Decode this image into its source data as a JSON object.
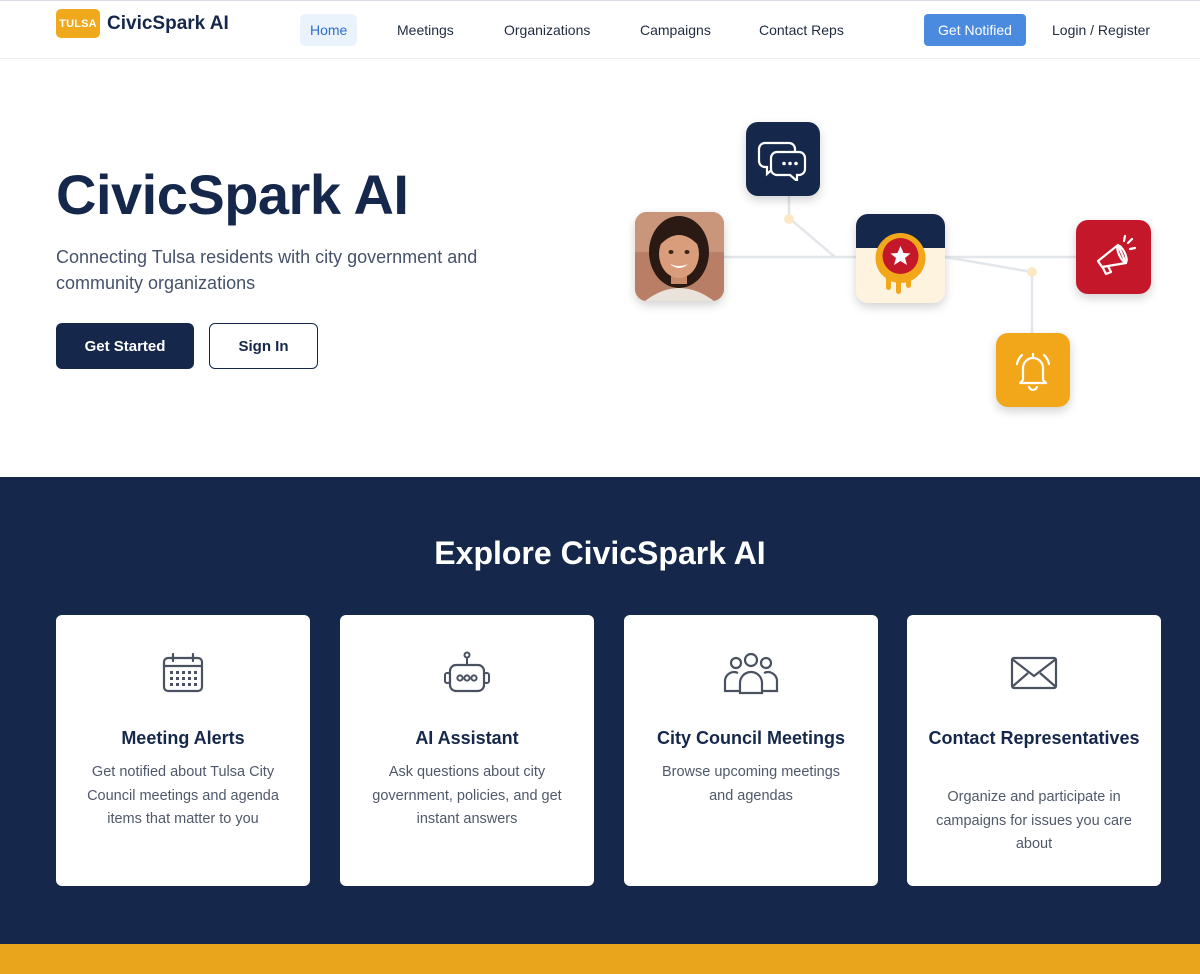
{
  "header": {
    "logo_badge": "TULSA",
    "logo_text": "CivicSpark AI",
    "nav": [
      {
        "label": "Home",
        "active": true
      },
      {
        "label": "Meetings"
      },
      {
        "label": "Organizations"
      },
      {
        "label": "Campaigns"
      },
      {
        "label": "Contact Reps"
      }
    ],
    "notify_label": "Get Notified",
    "login_label": "Login / Register"
  },
  "hero": {
    "title": "CivicSpark AI",
    "subtitle": "Connecting Tulsa residents with city government and community organizations",
    "primary_button": "Get Started",
    "secondary_button": "Sign In"
  },
  "explore": {
    "title": "Explore CivicSpark AI",
    "cards": [
      {
        "icon": "calendar-icon",
        "title": "Meeting Alerts",
        "description": "Get notified about Tulsa City Council meetings and agenda items that matter to you"
      },
      {
        "icon": "robot-icon",
        "title": "AI Assistant",
        "description": "Ask questions about city government, policies, and get instant answers"
      },
      {
        "icon": "people-group-icon",
        "title": "City Council Meetings",
        "description": "Browse upcoming meetings and agendas"
      },
      {
        "icon": "envelope-icon",
        "title": "Contact Representatives",
        "description": "Organize and participate in campaigns for issues you care about"
      }
    ]
  },
  "colors": {
    "navy": "#15284b",
    "accent_blue": "#4a8be0",
    "gold": "#f0a81c",
    "red": "#c4182a"
  }
}
